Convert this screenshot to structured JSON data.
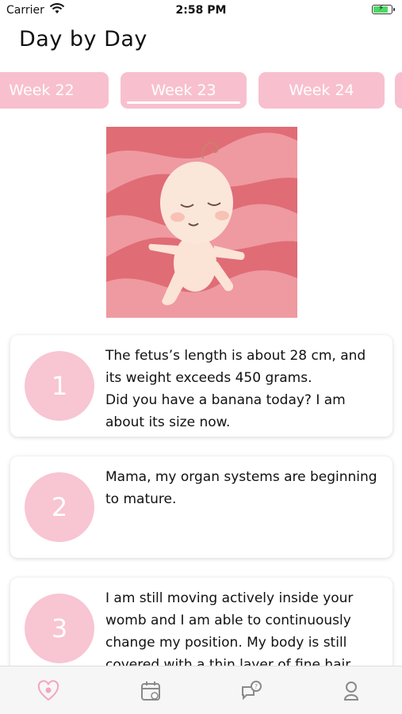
{
  "status_bar": {
    "carrier": "Carrier",
    "time": "2:58 PM"
  },
  "header": {
    "title": "Day by Day"
  },
  "weeks": [
    {
      "label": "Week 22",
      "selected": false
    },
    {
      "label": "Week 23",
      "selected": true
    },
    {
      "label": "Week 24",
      "selected": false
    }
  ],
  "cards": [
    {
      "number": "1",
      "text": "The fetus’s length is about 28 cm, and its weight exceeds 450 grams.\nDid you have a banana today? I am about its size now."
    },
    {
      "number": "2",
      "text": "Mama, my organ systems are beginning to mature."
    },
    {
      "number": "3",
      "text": "I am still moving actively inside your womb and I am able to continuously change my position. My body is still covered with a thin layer of fine hair."
    }
  ],
  "tab_bar": {
    "items": [
      {
        "icon": "heart-baby-icon",
        "active": true
      },
      {
        "icon": "calendar-icon",
        "active": false
      },
      {
        "icon": "chat-question-icon",
        "active": false
      },
      {
        "icon": "baby-icon",
        "active": false
      }
    ]
  },
  "colors": {
    "accent_pink": "#f8c0cf",
    "hero_bg": "#e87a82"
  }
}
